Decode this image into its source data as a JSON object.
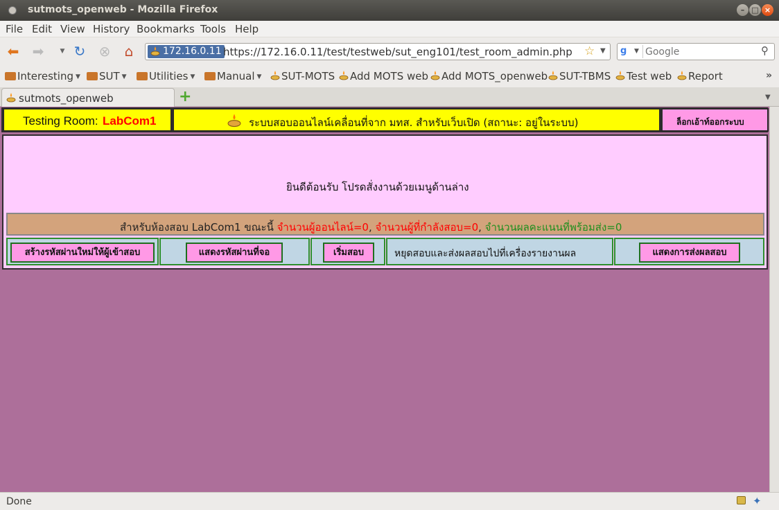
{
  "window": {
    "title": "sutmots_openweb - Mozilla Firefox"
  },
  "menu": {
    "items": [
      {
        "label": "File"
      },
      {
        "label": "Edit"
      },
      {
        "label": "View"
      },
      {
        "label": "History"
      },
      {
        "label": "Bookmarks"
      },
      {
        "label": "Tools"
      },
      {
        "label": "Help"
      }
    ]
  },
  "nav": {
    "site_identity": "172.16.0.11",
    "url": "https://172.16.0.11/test/testweb/sut_eng101/test_room_admin.php",
    "search_placeholder": "Google"
  },
  "bookmarks": {
    "items": [
      {
        "label": "Interesting",
        "type": "folder"
      },
      {
        "label": "SUT",
        "type": "folder"
      },
      {
        "label": "Utilities",
        "type": "folder"
      },
      {
        "label": "Manual",
        "type": "folder"
      },
      {
        "label": "SUT-MOTS",
        "type": "link"
      },
      {
        "label": "Add MOTS web",
        "type": "link"
      },
      {
        "label": "Add MOTS_openweb",
        "type": "link"
      },
      {
        "label": "SUT-TBMS",
        "type": "link"
      },
      {
        "label": "Test web",
        "type": "link"
      },
      {
        "label": "Report",
        "type": "link"
      }
    ],
    "overflow": "»"
  },
  "tabs": [
    {
      "label": "sutmots_openweb",
      "active": true
    }
  ],
  "page": {
    "room_label": "Testing  Room:",
    "room_name": "LabCom1",
    "system_title": "ระบบสอบออนไลน์เคลื่อนที่จาก มทส. สำหรับเว็บเปิด (สถานะ: อยู่ในระบบ)",
    "logout_label": "ล็อกเอ้าท์ออกระบบ",
    "welcome": "ยินดีต้อนรับ  โปรดสั่งงานด้วยเมนูด้านล่าง",
    "status": {
      "prefix": "สำหรับห้องสอบ  LabCom1  ขณะนี้ ",
      "online": "จำนวนผู้ออนไลน์=0",
      "testing": "จำนวนผู้ที่กำลังสอบ=0",
      "scores": "จำนวนผลคะแนนที่พร้อมส่ง=0",
      "sep1": ", ",
      "sep2": ", "
    },
    "actions": {
      "create_password": "สร้างรหัสผ่านใหม่ให้ผู้เข้าสอบ",
      "show_password": "แสดงรหัสผ่านที่จอ",
      "start_test": "เริ่มสอบ",
      "stop_and_send": "หยุดสอบและส่งผลสอบไปที่เครื่องรายงานผล",
      "show_send_status": "แสดงการส่งผลสอบ"
    }
  },
  "statusbar": {
    "text": "Done"
  },
  "colors": {
    "content_bg": "#ad6f9a",
    "header_yellow": "#ffff00",
    "pink_button": "#ff99e6",
    "panel_pink": "#ffccff",
    "status_tan": "#d3a37c",
    "action_blue": "#c0d6e4",
    "red_text": "#ff0000",
    "green_text": "#1f8f1f"
  }
}
